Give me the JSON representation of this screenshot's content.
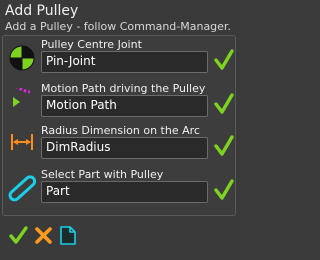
{
  "panel": {
    "title": "Add Pulley",
    "subtitle": "Add a Pulley - follow Command-Manager."
  },
  "rows": [
    {
      "label": "Pulley Centre Joint",
      "value": "Pin-Joint",
      "icon": "pin-joint-icon",
      "status": "ok"
    },
    {
      "label": "Motion Path driving the Pulley",
      "value": "Motion Path",
      "icon": "motion-path-icon",
      "status": "ok"
    },
    {
      "label": "Radius Dimension on the Arc",
      "value": "DimRadius",
      "icon": "radius-dimension-icon",
      "status": "ok"
    },
    {
      "label": "Select Part with Pulley",
      "value": "Part",
      "icon": "part-link-icon",
      "status": "ok"
    }
  ],
  "actions": {
    "ok": "check-icon",
    "cancel": "close-icon",
    "new": "new-document-icon"
  },
  "colors": {
    "check_green": "#7ed321",
    "cancel_orange": "#ff9a1a",
    "cyan": "#19d0e8",
    "magenta": "#e02ad8",
    "orange": "#ff8c1a"
  }
}
